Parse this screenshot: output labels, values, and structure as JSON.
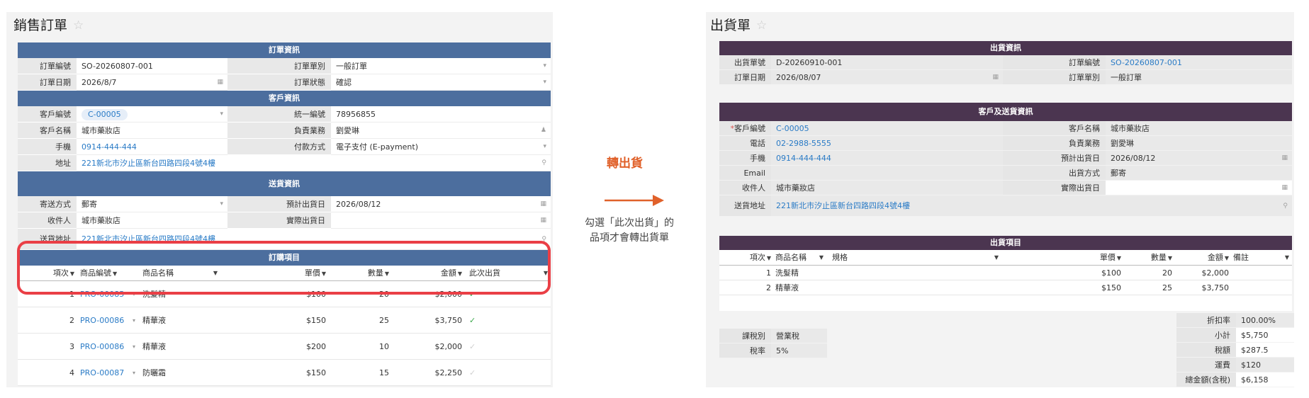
{
  "sales_order": {
    "title": "銷售訂單",
    "order_info_title": "訂單資訊",
    "order_no_label": "訂單編號",
    "order_no": "SO-20260807-001",
    "order_type_label": "訂單單別",
    "order_type": "一般訂單",
    "order_date_label": "訂單日期",
    "order_date": "2026/8/7",
    "order_status_label": "訂單狀態",
    "order_status": "確認",
    "customer_info_title": "客戶資訊",
    "customer_no_label": "客戶編號",
    "customer_no": "C-00005",
    "tax_id_label": "統一編號",
    "tax_id": "78956855",
    "customer_name_label": "客戶名稱",
    "customer_name": "城市藥妝店",
    "sales_rep_label": "負責業務",
    "sales_rep": "劉愛琳",
    "mobile_label": "手機",
    "mobile": "0914-444-444",
    "payment_label": "付款方式",
    "payment": "電子支付 (E-payment)",
    "address_label": "地址",
    "address": "221新北市汐止區新台四路四段4號4樓",
    "delivery_info_title": "送貨資訊",
    "ship_method_label": "寄送方式",
    "ship_method": "郵寄",
    "est_ship_date_label": "預計出貨日",
    "est_ship_date": "2026/08/12",
    "receiver_label": "收件人",
    "receiver": "城市藥妝店",
    "actual_ship_date_label": "實際出貨日",
    "actual_ship_date": "",
    "ship_address_label": "送貨地址",
    "ship_address": "221新北市汐止區新台四路四段4號4樓",
    "items_title": "訂購項目",
    "columns": {
      "no": "項次",
      "code": "商品編號",
      "name": "商品名稱",
      "price": "單價",
      "qty": "數量",
      "amount": "金額",
      "ship": "此次出貨"
    },
    "items": [
      {
        "no": "1",
        "code": "PRO-00085",
        "name": "洗髮精",
        "price": "$100",
        "qty": "20",
        "amount": "$2,000",
        "ship_now": true
      },
      {
        "no": "2",
        "code": "PRO-00086",
        "name": "精華液",
        "price": "$150",
        "qty": "25",
        "amount": "$3,750",
        "ship_now": true
      },
      {
        "no": "3",
        "code": "PRO-00086",
        "name": "精華液",
        "price": "$200",
        "qty": "10",
        "amount": "$2,000",
        "ship_now": false
      },
      {
        "no": "4",
        "code": "PRO-00087",
        "name": "防曬霜",
        "price": "$150",
        "qty": "15",
        "amount": "$2,250",
        "ship_now": false
      }
    ]
  },
  "transition": {
    "label": "轉出貨",
    "note_line1": "勾選「此次出貨」的",
    "note_line2": "品項才會轉出貨單"
  },
  "shipment": {
    "title": "出貨單",
    "info_title": "出貨資訊",
    "ship_no_label": "出貨單號",
    "ship_no": "D-20260910-001",
    "order_no_label": "訂單編號",
    "order_no": "SO-20260807-001",
    "order_date_label": "訂單日期",
    "order_date": "2026/08/07",
    "order_type_label": "訂單單別",
    "order_type": "一般訂單",
    "customer_title": "客戶及送貨資訊",
    "customer_no_label": "客戶編號",
    "customer_no": "C-00005",
    "customer_name_label": "客戶名稱",
    "customer_name": "城市藥妝店",
    "phone_label": "電話",
    "phone": "02-2988-5555",
    "sales_rep_label": "負責業務",
    "sales_rep": "劉愛琳",
    "mobile_label": "手機",
    "mobile": "0914-444-444",
    "est_ship_date_label": "預計出貨日",
    "est_ship_date": "2026/08/12",
    "email_label": "Email",
    "email": "",
    "ship_method_label": "出貨方式",
    "ship_method": "郵寄",
    "receiver_label": "收件人",
    "receiver": "城市藥妝店",
    "actual_ship_date_label": "實際出貨日",
    "actual_ship_date": "",
    "ship_address_label": "送貨地址",
    "ship_address": "221新北市汐止區新台四路四段4號4樓",
    "items_title": "出貨項目",
    "columns": {
      "no": "項次",
      "name": "商品名稱",
      "spec": "規格",
      "price": "單價",
      "qty": "數量",
      "amount": "金額",
      "remark": "備註"
    },
    "items": [
      {
        "no": "1",
        "name": "洗髮精",
        "spec": "",
        "price": "$100",
        "qty": "20",
        "amount": "$2,000",
        "remark": ""
      },
      {
        "no": "2",
        "name": "精華液",
        "spec": "",
        "price": "$150",
        "qty": "25",
        "amount": "$3,750",
        "remark": ""
      }
    ],
    "tax_type_label": "課稅別",
    "tax_type": "營業稅",
    "tax_rate_label": "稅率",
    "tax_rate": "5%",
    "discount_label": "折扣率",
    "discount": "100.00%",
    "subtotal_label": "小計",
    "subtotal": "$5,750",
    "tax_label": "稅額",
    "tax": "$287.5",
    "shipping_fee_label": "運費",
    "shipping_fee": "$120",
    "total_label": "總金額(含稅)",
    "total": "$6,158"
  }
}
